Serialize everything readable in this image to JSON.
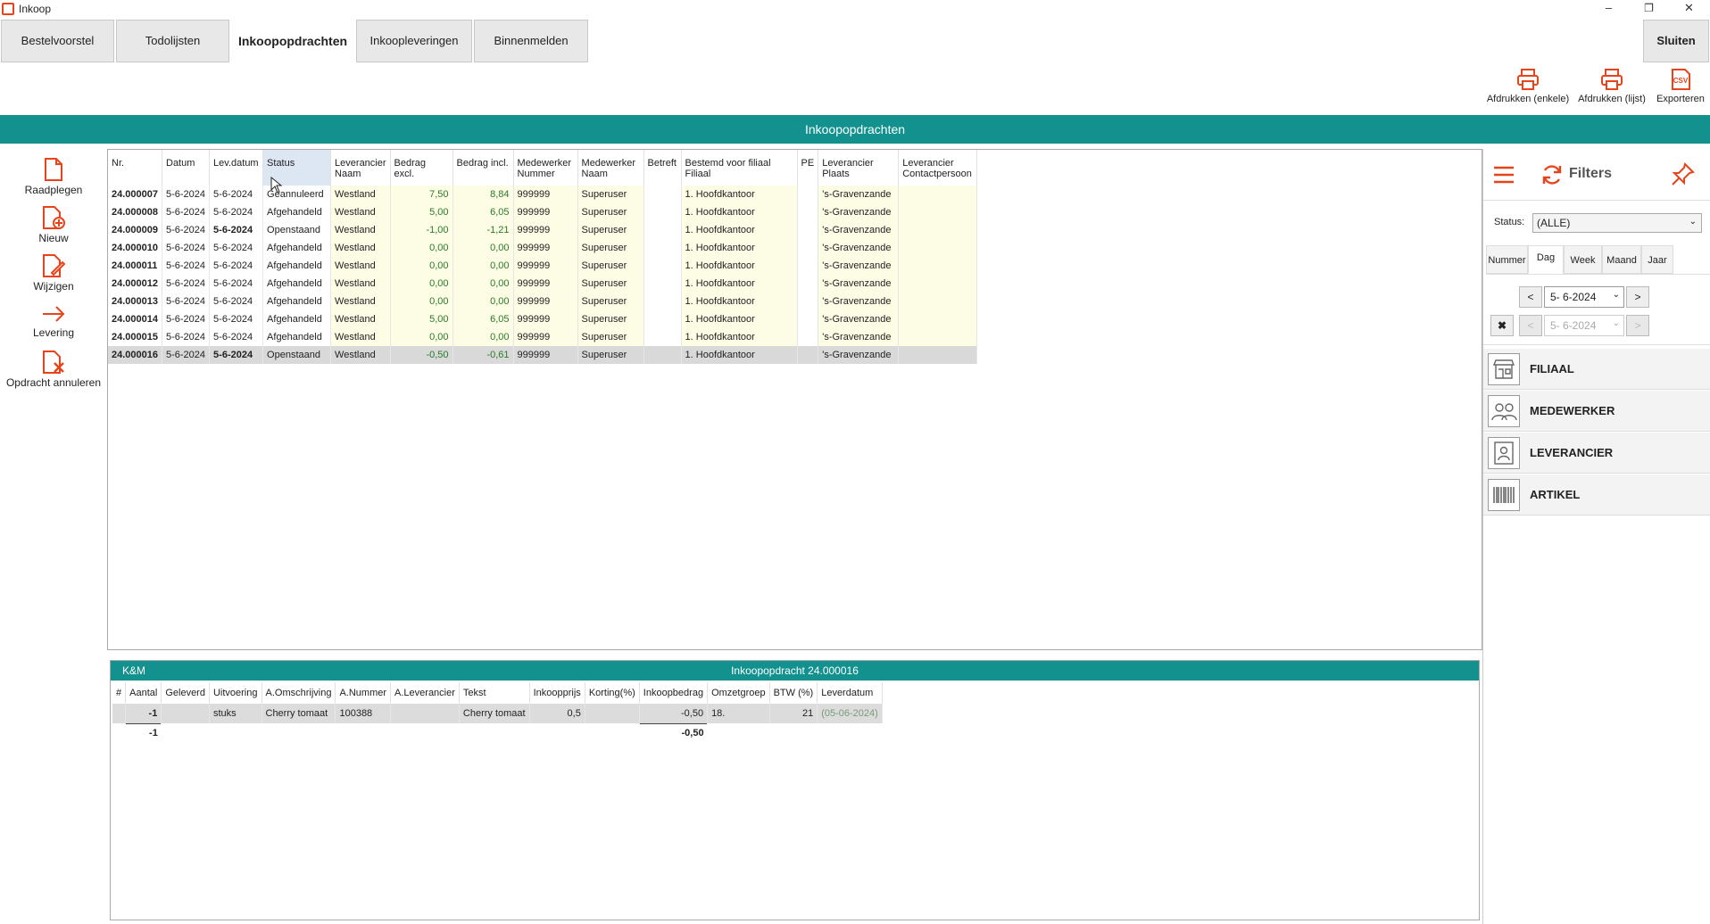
{
  "window": {
    "title": "Inkoop",
    "minimize": "–",
    "restore": "❐",
    "close": "✕"
  },
  "top_tabs": [
    {
      "label": "Bestelvoorstel"
    },
    {
      "label": "Todolijsten"
    },
    {
      "label": "Inkoopopdrachten",
      "active": true
    },
    {
      "label": "Inkoopleveringen"
    },
    {
      "label": "Binnenmelden"
    }
  ],
  "close_button": "Sluiten",
  "top_actions": [
    {
      "label": "Afdrukken (enkele)",
      "icon": "printer-icon"
    },
    {
      "label": "Afdrukken (lijst)",
      "icon": "printer-icon"
    },
    {
      "label": "Exporteren",
      "icon": "csv-icon"
    }
  ],
  "banner": "Inkoopopdrachten",
  "left_tools": [
    {
      "label": "Raadplegen",
      "icon": "document-icon"
    },
    {
      "label": "Nieuw",
      "icon": "document-add-icon"
    },
    {
      "label": "Wijzigen",
      "icon": "document-edit-icon"
    },
    {
      "label": "Levering",
      "icon": "arrow-right-icon"
    },
    {
      "label": "Opdracht annuleren",
      "icon": "document-cancel-icon"
    }
  ],
  "main_grid": {
    "columns": [
      [
        "Nr.",
        ""
      ],
      [
        "Datum",
        ""
      ],
      [
        "Lev.datum",
        ""
      ],
      [
        "Status",
        ""
      ],
      [
        "Leverancier",
        "Naam"
      ],
      [
        "Bedrag excl.",
        ""
      ],
      [
        "Bedrag incl.",
        ""
      ],
      [
        "Medewerker",
        "Nummer"
      ],
      [
        "Medewerker",
        "Naam"
      ],
      [
        "Betreft",
        ""
      ],
      [
        "Bestemd voor filiaal",
        "Filiaal"
      ],
      [
        "PE",
        ""
      ],
      [
        "Leverancier",
        "Plaats"
      ],
      [
        "Leverancier",
        "Contactpersoon"
      ]
    ],
    "rows": [
      [
        "24.000007",
        "5-6-2024",
        "5-6-2024",
        "Geannuleerd",
        "Westland",
        "7,50",
        "8,84",
        "999999",
        "Superuser",
        "",
        "1. Hoofdkantoor",
        "",
        "'s-Gravenzande",
        ""
      ],
      [
        "24.000008",
        "5-6-2024",
        "5-6-2024",
        "Afgehandeld",
        "Westland",
        "5,00",
        "6,05",
        "999999",
        "Superuser",
        "",
        "1. Hoofdkantoor",
        "",
        "'s-Gravenzande",
        ""
      ],
      [
        "24.000009",
        "5-6-2024",
        "5-6-2024",
        "Openstaand",
        "Westland",
        "-1,00",
        "-1,21",
        "999999",
        "Superuser",
        "",
        "1. Hoofdkantoor",
        "",
        "'s-Gravenzande",
        ""
      ],
      [
        "24.000010",
        "5-6-2024",
        "5-6-2024",
        "Afgehandeld",
        "Westland",
        "0,00",
        "0,00",
        "999999",
        "Superuser",
        "",
        "1. Hoofdkantoor",
        "",
        "'s-Gravenzande",
        ""
      ],
      [
        "24.000011",
        "5-6-2024",
        "5-6-2024",
        "Afgehandeld",
        "Westland",
        "0,00",
        "0,00",
        "999999",
        "Superuser",
        "",
        "1. Hoofdkantoor",
        "",
        "'s-Gravenzande",
        ""
      ],
      [
        "24.000012",
        "5-6-2024",
        "5-6-2024",
        "Afgehandeld",
        "Westland",
        "0,00",
        "0,00",
        "999999",
        "Superuser",
        "",
        "1. Hoofdkantoor",
        "",
        "'s-Gravenzande",
        ""
      ],
      [
        "24.000013",
        "5-6-2024",
        "5-6-2024",
        "Afgehandeld",
        "Westland",
        "0,00",
        "0,00",
        "999999",
        "Superuser",
        "",
        "1. Hoofdkantoor",
        "",
        "'s-Gravenzande",
        ""
      ],
      [
        "24.000014",
        "5-6-2024",
        "5-6-2024",
        "Afgehandeld",
        "Westland",
        "5,00",
        "6,05",
        "999999",
        "Superuser",
        "",
        "1. Hoofdkantoor",
        "",
        "'s-Gravenzande",
        ""
      ],
      [
        "24.000015",
        "5-6-2024",
        "5-6-2024",
        "Afgehandeld",
        "Westland",
        "0,00",
        "0,00",
        "999999",
        "Superuser",
        "",
        "1. Hoofdkantoor",
        "",
        "'s-Gravenzande",
        ""
      ],
      [
        "24.000016",
        "5-6-2024",
        "5-6-2024",
        "Openstaand",
        "Westland",
        "-0,50",
        "-0,61",
        "999999",
        "Superuser",
        "",
        "1. Hoofdkantoor",
        "",
        "'s-Gravenzande",
        ""
      ]
    ],
    "selected_row": 9
  },
  "filters": {
    "title": "Filters",
    "status_label": "Status:",
    "status_value": "(ALLE)",
    "period_tabs": [
      {
        "label": "Nummer"
      },
      {
        "label": "Dag",
        "active": true
      },
      {
        "label": "Week"
      },
      {
        "label": "Maand"
      },
      {
        "label": "Jaar"
      }
    ],
    "date_from": "5- 6-2024",
    "date_to": "5- 6-2024",
    "prev": "<",
    "next": ">",
    "sections": [
      {
        "label": "FILIAAL",
        "icon": "store-icon"
      },
      {
        "label": "MEDEWERKER",
        "icon": "users-icon"
      },
      {
        "label": "LEVERANCIER",
        "icon": "contact-icon"
      },
      {
        "label": "ARTIKEL",
        "icon": "barcode-icon"
      }
    ]
  },
  "detail": {
    "company": "K&M",
    "title": "Inkoopopdracht 24.000016",
    "columns": [
      "#",
      "Aantal",
      "Geleverd",
      "Uitvoering",
      "A.Omschrijving",
      "A.Nummer",
      "A.Leverancier",
      "Tekst",
      "Inkoopprijs",
      "Korting(%)",
      "Inkoopbedrag",
      "Omzetgroep",
      "BTW (%)",
      "Leverdatum"
    ],
    "rows": [
      [
        "",
        "-1",
        "",
        "stuks",
        "Cherry tomaat",
        "100388",
        "",
        "Cherry tomaat",
        "0,5",
        "",
        "-0,50",
        "18.",
        "21",
        "(05-06-2024)"
      ]
    ],
    "totals": {
      "aantal": "-1",
      "inkoopbedrag": "-0,50"
    }
  }
}
